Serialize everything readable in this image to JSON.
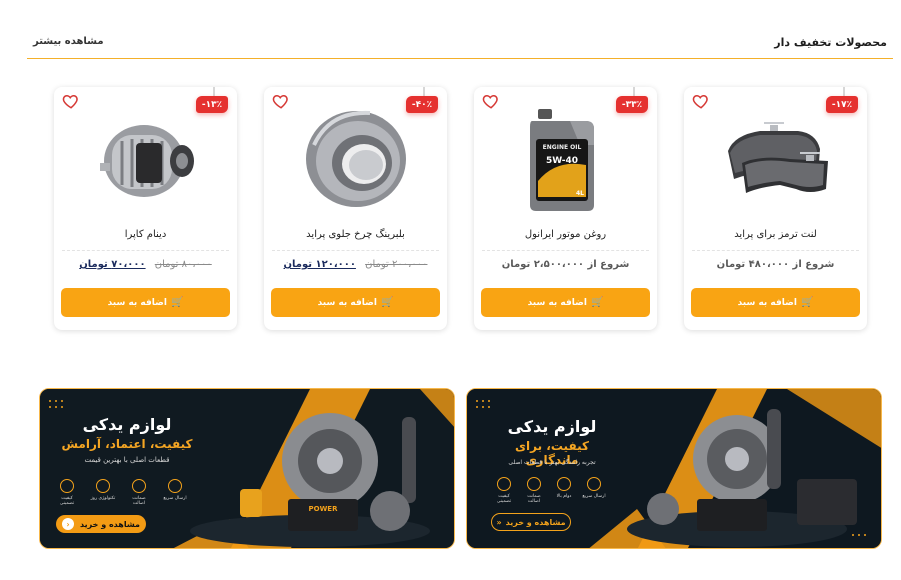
{
  "section": {
    "title": "محصولات تخفیف دار",
    "see_more": "مشاهده بیشتر"
  },
  "products": [
    {
      "name": "لنت ترمز برای پراید",
      "discount": "۱۷٪-",
      "price_text": "شروع از ۴۸۰،۰۰۰ تومان",
      "button": "اضافه به سبد"
    },
    {
      "name": "روغن موتور ایرانول",
      "discount": "۳۳٪-",
      "price_text": "شروع از ۲،۵۰۰،۰۰۰ تومان",
      "button": "اضافه به سبد"
    },
    {
      "name": "بلبرینگ چرخ جلوی پراید",
      "discount": "۴۰٪-",
      "old_price": "۲۰۰،۰۰۰ تومان",
      "new_price": "۱۲۰،۰۰۰ تومان",
      "button": "اضافه به سبد"
    },
    {
      "name": "دینام کاپرا",
      "discount": "۱۳٪-",
      "old_price": "۸۰،۰۰۰ تومان",
      "new_price": "۷۰،۰۰۰ تومان",
      "button": "اضافه به سبد"
    }
  ],
  "banners": [
    {
      "title": "لوازم یدکی",
      "subtitle": "کیفیت، برای ماندگاری",
      "tagline": "تجربه رانندگی بهتر با قطعات اصلی",
      "features": [
        "ارسال سریع",
        "دوام بالا",
        "ضمانت اصالت",
        "کیفیت تضمینی"
      ],
      "button": "مشاهده و خرید"
    },
    {
      "title": "لوازم یدکی",
      "subtitle": "کیفیت، اعتماد، آرامش",
      "tagline": "قطعات اصلی با بهترین قیمت",
      "features": [
        "ارسال سریع",
        "ضمانت اصالت",
        "تکنولوژی روز",
        "کیفیت تضمینی"
      ],
      "button": "مشاهده و خرید",
      "product_label": "POWER"
    }
  ],
  "oil_label": {
    "brand": "ENGINE OIL",
    "grade": "5W-40",
    "volume": "4L"
  },
  "colors": {
    "accent": "#f9a413",
    "badge": "#e5312f",
    "price": "#1a2a5c",
    "divider": "#f4b02a"
  }
}
